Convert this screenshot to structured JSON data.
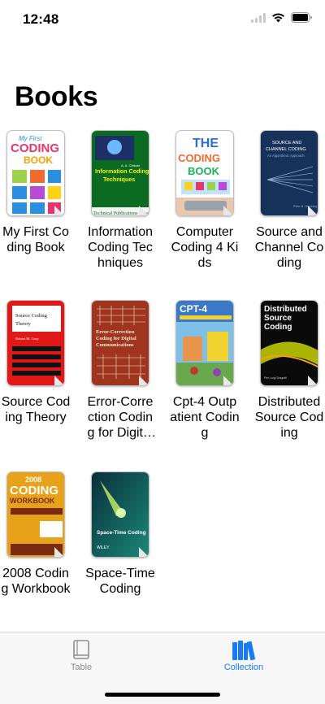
{
  "status_bar": {
    "time": "12:48"
  },
  "page": {
    "title": "Books"
  },
  "books": [
    {
      "title": "My First Coding Book",
      "cover_text": [
        "My First",
        "CODING",
        "BOOK"
      ],
      "cover_color": "#ffffff",
      "accent": "#2a8fe0"
    },
    {
      "title": "Information Coding Techniques",
      "cover_text": [
        "Information Coding",
        "Techniques",
        "Technical Publications Pune"
      ],
      "cover_color": "#0b6b22",
      "accent": "#f5f500"
    },
    {
      "title": "Computer Coding 4 Kids",
      "cover_text": [
        "THE",
        "CODING",
        "BOOK"
      ],
      "cover_color": "#ffffff",
      "accent": "#2b6fd6"
    },
    {
      "title": "Source and Channel Coding",
      "cover_text": [
        "SOURCE AND",
        "CHANNEL CODING",
        "An Algorithmic Approach"
      ],
      "cover_color": "#17325a",
      "accent": "#8fb0d6"
    },
    {
      "title": "Source Coding Theory",
      "cover_text": [
        "Source Coding",
        "Theory",
        "Robert M. Gray"
      ],
      "cover_color": "#e01818",
      "accent": "#111111"
    },
    {
      "title": "Error-Correction Coding for Digital Communications",
      "cover_text": [
        "Error-Correction",
        "Coding for Digital",
        "Communications"
      ],
      "cover_color": "#a0351f",
      "accent": "#f2e6c8"
    },
    {
      "title": "Cpt-4 Outpatient Coding",
      "cover_text": [
        "CPT-4"
      ],
      "cover_color": "#3b78c8",
      "accent": "#f2d22e"
    },
    {
      "title": "Distributed Source Coding",
      "cover_text": [
        "Distributed",
        "Source",
        "Coding"
      ],
      "cover_color": "#0a0a0a",
      "accent": "#c8d200"
    },
    {
      "title": "2008 Coding Workbook",
      "cover_text": [
        "2008",
        "CODING",
        "WORKBOOK"
      ],
      "cover_color": "#e8a21a",
      "accent": "#7a2a10"
    },
    {
      "title": "Space-Time Coding",
      "cover_text": [
        "Space-Time Coding",
        "WILEY"
      ],
      "cover_color": "#0f5a5e",
      "accent": "#c8f06a"
    }
  ],
  "tab_bar": {
    "tabs": [
      {
        "label": "Table",
        "icon": "book-icon",
        "selected": false
      },
      {
        "label": "Collection",
        "icon": "books-collection-icon",
        "selected": true
      }
    ]
  },
  "colors": {
    "accent": "#1a7cf5",
    "inactive": "#8e8e93"
  }
}
